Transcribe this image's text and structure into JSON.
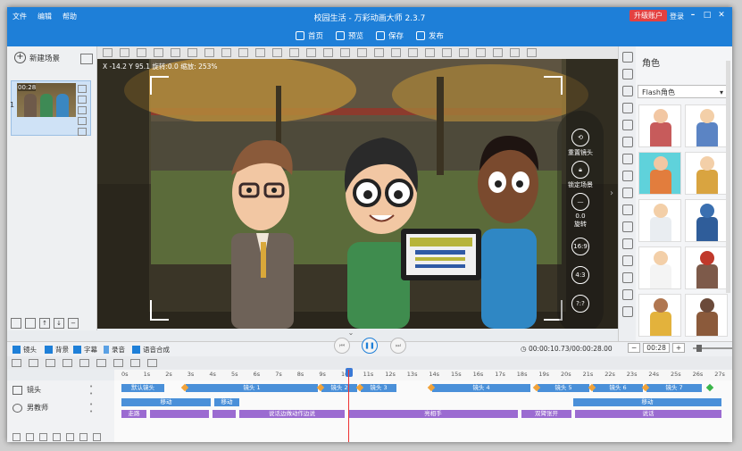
{
  "titlebar": {
    "menu": [
      "文件",
      "编辑",
      "帮助"
    ],
    "title": "校园生活 - 万彩动画大师 2.3.7",
    "upgrade": "升级账户",
    "login": "登录"
  },
  "actionbar": {
    "items": [
      {
        "label": "首页",
        "icon": "home-icon"
      },
      {
        "label": "预览",
        "icon": "preview-icon"
      },
      {
        "label": "保存",
        "icon": "save-icon"
      },
      {
        "label": "发布",
        "icon": "publish-icon"
      }
    ]
  },
  "scenes": {
    "new_scene": "新建场景",
    "items": [
      {
        "number": "1",
        "time": "00:28"
      }
    ]
  },
  "stage": {
    "coords": "X -14.2  Y 95.1  旋转:0.0  缩放: 253%"
  },
  "camera_tools": {
    "reset": "重置镜头",
    "lock": "锁定场景",
    "rotate_value": "0.0",
    "rotate": "旋转",
    "ratio_169": "16:9",
    "ratio_43": "4:3",
    "ratio_custom": "?:?"
  },
  "char_panel": {
    "title": "角色",
    "category": "Flash角色",
    "items": [
      {
        "name": "woman-teacher",
        "head": "#f2c7a3",
        "body": "#c75b5b",
        "selected": false
      },
      {
        "name": "bald-man",
        "head": "#f3cfa8",
        "body": "#5b84c4",
        "selected": false
      },
      {
        "name": "red-hair-girl",
        "head": "#f2c7a3",
        "body": "#e27d3d",
        "selected": true
      },
      {
        "name": "blonde-boy",
        "head": "#f3cfa8",
        "body": "#d9a440",
        "selected": false
      },
      {
        "name": "doctor",
        "head": "#f3cfa8",
        "body": "#e9edf1",
        "selected": false
      },
      {
        "name": "blue-robot",
        "head": "#3a6fb0",
        "body": "#2f5d9a",
        "selected": false
      },
      {
        "name": "scientist",
        "head": "#f3cfa8",
        "body": "#f4f4f4",
        "selected": false
      },
      {
        "name": "red-robot",
        "head": "#c0392b",
        "body": "#7d5a4a",
        "selected": false
      },
      {
        "name": "jumping-boy",
        "head": "#b07650",
        "body": "#e3b23c",
        "selected": false
      },
      {
        "name": "office-desk",
        "head": "#6b4a3a",
        "body": "#8b5a3b",
        "selected": false
      }
    ]
  },
  "timeline": {
    "tools": {
      "camera": "镜头",
      "background": "背景",
      "subtitle": "字幕",
      "record": "录音",
      "tts": "语音合成"
    },
    "timecode": "00:00:10.73/00:00:28.00",
    "zoom": "00:28",
    "ruler": [
      "0s",
      "1s",
      "2s",
      "3s",
      "4s",
      "5s",
      "6s",
      "7s",
      "8s",
      "9s",
      "10s",
      "11s",
      "12s",
      "13s",
      "14s",
      "15s",
      "16s",
      "17s",
      "18s",
      "19s",
      "20s",
      "21s",
      "22s",
      "23s",
      "24s",
      "25s",
      "26s",
      "27s",
      "28s"
    ],
    "tracks": [
      {
        "name": "镜头",
        "icon": "camera-icon"
      },
      {
        "name": "男教师",
        "icon": "person-icon"
      }
    ],
    "camera_clips": [
      "默认镜头",
      "镜头 1",
      "镜头 2",
      "镜头 3",
      "镜头 4",
      "镜头 5",
      "镜头 6",
      "镜头 7"
    ],
    "move_clips": [
      "移动",
      "移动",
      "移动"
    ],
    "action_clips": [
      "走路",
      "说话边做动作边说",
      "亮相手",
      "双臂张开",
      "说话"
    ]
  },
  "colors": {
    "brand": "#1e7fd8",
    "upgrade": "#e34141",
    "clip_blue": "#4a90d9",
    "clip_purple": "#9b6bd1",
    "keyframe": "#f2a33a",
    "playhead": "#e33333",
    "selected_char": "#5fd2db"
  }
}
